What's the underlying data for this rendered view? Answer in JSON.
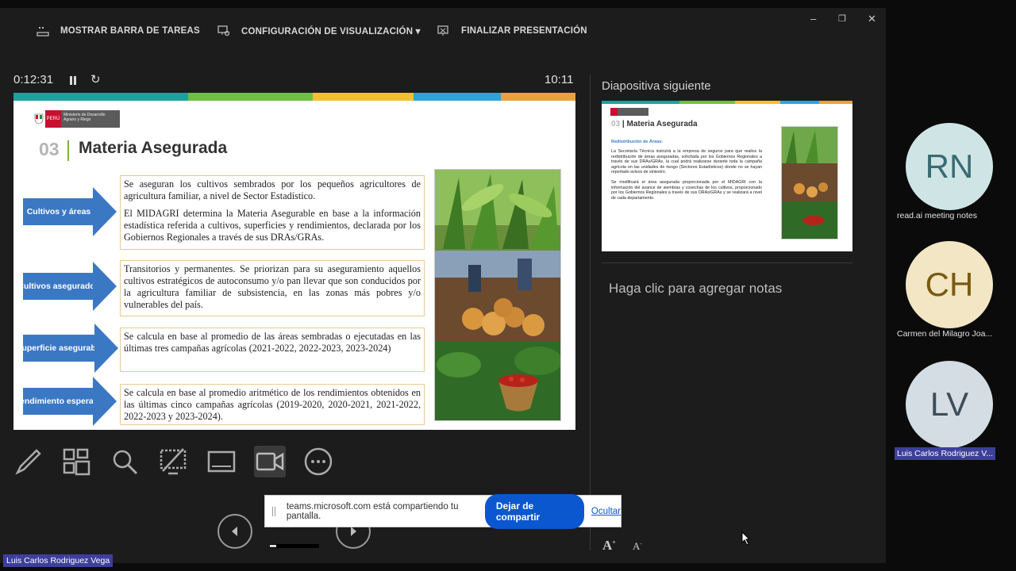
{
  "toolbar": {
    "taskbar_label": "MOSTRAR BARRA DE TAREAS",
    "display_settings_label": "CONFIGURACIÓN DE VISUALIZACIÓN ▾",
    "end_show_label": "FINALIZAR PRESENTACIÓN",
    "minimize": "–",
    "restore": "❐",
    "close": "✕"
  },
  "status": {
    "elapsed": "0:12:31",
    "clock": "10:11"
  },
  "slide": {
    "logo_country": "PERÚ",
    "logo_ministry": "Ministerio de Desarrollo Agrario y Riego",
    "section_number": "03",
    "section_title": "Materia Asegurada",
    "rows": [
      {
        "label": "Cultivos y áreas",
        "paragraphs": [
          "Se aseguran los cultivos sembrados por los pequeños agricultores de agricultura familiar, a nivel de Sector Estadístico.",
          "El MIDAGRI determina la Materia Asegurable en base a la información estadística referida a cultivos, superficies y rendimientos, declarada por los Gobiernos Regionales a través de sus DRAs/GRAs."
        ]
      },
      {
        "label": "Cultivos asegurados",
        "paragraphs": [
          "Transitorios y permanentes. Se priorizan para su aseguramiento aquellos cultivos estratégicos de autoconsumo y/o pan llevar que son conducidos por la agricultura familiar de subsistencia, en las zonas más pobres y/o vulnerables del país."
        ]
      },
      {
        "label": "Superficie asegurable",
        "paragraphs": [
          "Se calcula en base al promedio de las áreas sembradas o ejecutadas en las últimas tres campañas agrícolas (2021-2022, 2022-2023, 2023-2024)"
        ]
      },
      {
        "label": "Rendimiento esperado",
        "paragraphs": [
          "Se calcula en base al promedio aritmético de los rendimientos obtenidos en las últimas cinco campañas agrícolas (2019-2020, 2020-2021, 2021-2022, 2022-2023 y 2023-2024)."
        ]
      }
    ],
    "stripe_colors": [
      "#1aa2a0",
      "#6fbf44",
      "#f2c12e",
      "#2ea3d8",
      "#e8a33a"
    ]
  },
  "tools": [
    "pen-icon",
    "grid-icon",
    "magnifier-icon",
    "screen-off-icon",
    "subtitles-icon",
    "camera-icon",
    "more-icon"
  ],
  "next": {
    "label": "Diapositiva siguiente",
    "title": "Materia Asegurada",
    "number": "03",
    "subtitle": "Redistribución de Áreas:",
    "paragraphs": [
      "La Secretaría Técnica instruirá a la empresa de seguros para que realice la redistribución de áreas aseguradas, solicitada por los Gobiernos Regionales a través de sus DRAs/GRAs, la cual podrá realizarse durante toda la campaña agrícola en las unidades de riesgo (Sectores Estadísticos) donde no se hayan reportado avisos de siniestro.",
      "Se modificará el área asegurada proporcionada por el MIDAGRI con la información del avance de siembras y cosechas de los cultivos, proporcionado por los Gobiernos Regionales a través de sus DRAs/GRAs y se realizará a nivel de cada departamento."
    ]
  },
  "notes": {
    "placeholder": "Haga clic para agregar notas"
  },
  "share_banner": {
    "message": "teams.microsoft.com está compartiendo tu pantalla.",
    "stop_label": "Dejar de compartir",
    "hide_label": "Ocultar"
  },
  "participants": [
    {
      "initials": "RN",
      "name": "read.ai meeting notes",
      "bg": "#cfe5e5",
      "fg": "#3a6b72"
    },
    {
      "initials": "CH",
      "name": "Carmen del Milagro Joa...",
      "bg": "#f2e6c4",
      "fg": "#7a5a12"
    },
    {
      "initials": "LV",
      "name": "Luis Carlos Rodriguez V...",
      "bg": "#d3dde3",
      "fg": "#3d4d58"
    }
  ],
  "self_name": "Luis Carlos Rodriguez Vega"
}
